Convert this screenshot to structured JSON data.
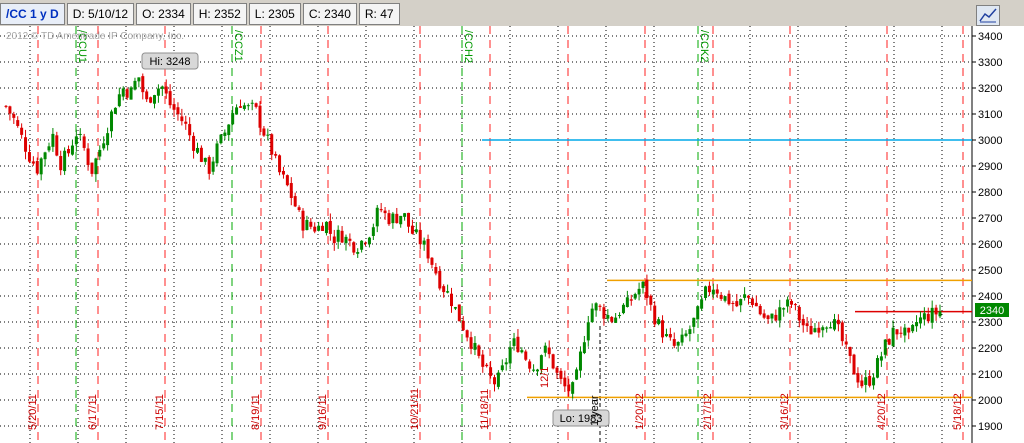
{
  "header": {
    "symbol": "/CC 1 y D",
    "date": "D: 5/10/12",
    "open": "O: 2334",
    "high": "H: 2352",
    "low": "L: 2305",
    "close": "C: 2340",
    "range": "R: 47"
  },
  "watermark": "2012 © TD Ameritrade IP Company, Inc.",
  "colors": {
    "up": "#008800",
    "down": "#dd0000",
    "grid": "#000000",
    "date_line": "#ff2020",
    "expiry_line": "#00aa00",
    "resistance": "#00a8e8",
    "range_band": "#f0a000",
    "price_tag": "#008800"
  },
  "chart_data": {
    "type": "candlestick",
    "ylim": [
      1900,
      3400
    ],
    "yticks": [
      1900,
      2000,
      2100,
      2200,
      2300,
      2400,
      2500,
      2600,
      2700,
      2800,
      2900,
      3000,
      3100,
      3200,
      3300,
      3400
    ],
    "date_labels": [
      "5/20/11",
      "6/17/11",
      "7/15/11",
      "8/19/11",
      "9/16/11",
      "10/21/11",
      "11/18/11",
      "1/20/12",
      "2/17/12",
      "3/16/12",
      "4/20/12",
      "5/18/12"
    ],
    "extra_labels": [
      "12/1",
      "1 year"
    ],
    "expiry_labels": [
      "/CCU1",
      "/CCZ1",
      "/CCH2",
      "/CCK2"
    ],
    "annotations": {
      "high_label": "Hi: 3248",
      "low_label": "Lo: 1983",
      "last_price": "2340"
    },
    "hlines": {
      "resistance": 3000,
      "range_top": 2460,
      "range_bottom": 2010,
      "last_price": 2340
    },
    "close_path": [
      3130,
      3080,
      3010,
      2940,
      2890,
      2960,
      3020,
      2910,
      2950,
      3030,
      2970,
      2880,
      2960,
      3050,
      3140,
      3200,
      3180,
      3250,
      3140,
      3190,
      3210,
      3140,
      3100,
      3060,
      2990,
      2940,
      2880,
      2960,
      3020,
      3100,
      3150,
      3120,
      3120,
      3040,
      2970,
      2880,
      2830,
      2760,
      2680,
      2670,
      2660,
      2690,
      2620,
      2640,
      2610,
      2590,
      2620,
      2660,
      2740,
      2700,
      2700,
      2720,
      2650,
      2620,
      2580,
      2510,
      2440,
      2400,
      2330,
      2270,
      2210,
      2140,
      2090,
      2060,
      2130,
      2220,
      2210,
      2150,
      2120,
      2200,
      2160,
      2080,
      2040,
      2040,
      2200,
      2350,
      2360,
      2330,
      2310,
      2350,
      2370,
      2420,
      2440,
      2340,
      2280,
      2230,
      2200,
      2230,
      2280,
      2340,
      2420,
      2440,
      2400,
      2380,
      2360,
      2400,
      2380,
      2330,
      2300,
      2330,
      2360,
      2370,
      2310,
      2260,
      2280,
      2300,
      2310,
      2260,
      2180,
      2110,
      2060,
      2080,
      2140,
      2210,
      2260,
      2270,
      2230,
      2300,
      2320,
      2330,
      2340
    ]
  }
}
